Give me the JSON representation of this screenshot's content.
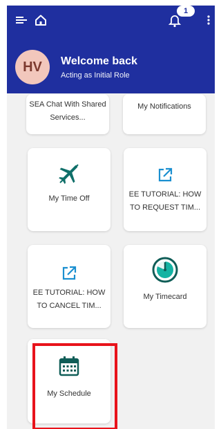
{
  "header": {
    "notification_count": "1",
    "avatar_initials": "HV",
    "welcome_text": "Welcome back",
    "acting_text": "Acting as Initial Role"
  },
  "tiles": [
    {
      "label": "SEA Chat With Shared Services...",
      "icon": "chat-icon"
    },
    {
      "label": "My Notifications",
      "icon": "notifications-icon"
    },
    {
      "label": "My Time Off",
      "icon": "airplane-icon"
    },
    {
      "label": "EE TUTORIAL: HOW TO REQUEST TIM...",
      "icon": "external-link-icon"
    },
    {
      "label": "EE TUTORIAL: HOW TO CANCEL TIM...",
      "icon": "external-link-icon"
    },
    {
      "label": "My Timecard",
      "icon": "timecard-icon"
    },
    {
      "label": "My Schedule",
      "icon": "calendar-icon"
    }
  ],
  "colors": {
    "header_bg": "#1f2f9f",
    "icon_teal": "#0f6f69",
    "highlight": "#e8131b"
  }
}
